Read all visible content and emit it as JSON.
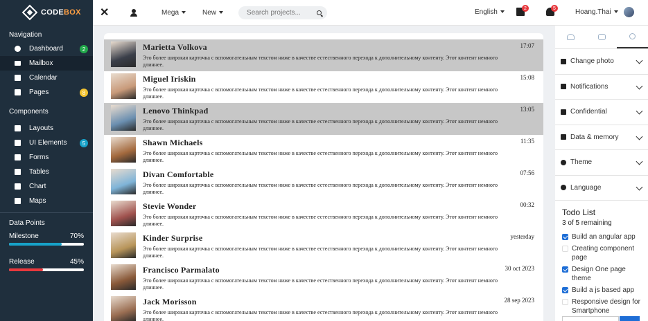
{
  "brand": {
    "text_a": "CODE",
    "text_b": "BOX"
  },
  "sidebar": {
    "navigation_heading": "Navigation",
    "nav_items": [
      {
        "label": "Dashboard",
        "icon": "dashboard-icon",
        "badge": "2"
      },
      {
        "label": "Mailbox",
        "icon": "envelope-icon",
        "active": true
      },
      {
        "label": "Calendar",
        "icon": "calendar-icon"
      },
      {
        "label": "Pages",
        "icon": "pages-icon",
        "badge": "8"
      }
    ],
    "components_heading": "Components",
    "component_items": [
      {
        "label": "Layouts",
        "icon": "layouts-icon"
      },
      {
        "label": "UI Elements",
        "icon": "ui-elements-icon",
        "badge": "5"
      },
      {
        "label": "Forms",
        "icon": "forms-icon"
      },
      {
        "label": "Tables",
        "icon": "tables-icon"
      },
      {
        "label": "Chart",
        "icon": "chart-icon"
      },
      {
        "label": "Maps",
        "icon": "map-icon"
      }
    ],
    "data_points_heading": "Data Points",
    "milestone": {
      "label": "Milestone",
      "value": "70%",
      "fraction": 0.7,
      "color": "#17a2c9"
    },
    "release": {
      "label": "Release",
      "value": "45%",
      "fraction": 0.45,
      "color": "#e8383d"
    }
  },
  "topbar": {
    "menu_mega": "Mega",
    "menu_new": "New",
    "search_placeholder": "Search projects...",
    "language": "English",
    "grid_badge": "2",
    "bell_badge": "5",
    "user_name": "Hoang.Thai"
  },
  "messages": [
    {
      "name": "Marietta Volkova",
      "time": "17:07",
      "text": "Это более широкая карточка с вспомогательным текстом ниже в качестве естественного перехода к дополнительному контенту. Этот контент немного длиннее.",
      "highlight": true,
      "avatar": "#3b3f4a"
    },
    {
      "name": "Miguel Iriskin",
      "time": "15:08",
      "text": "Это более широкая карточка с вспомогательным текстом ниже в качестве естественного перехода к дополнительному контенту. Этот контент немного длиннее.",
      "highlight": false,
      "avatar": "#c89a7a"
    },
    {
      "name": "Lenovo Thinkpad",
      "time": "13:05",
      "text": "Это более широкая карточка с вспомогательным текстом ниже в качестве естественного перехода к дополнительному контенту. Этот контент немного длиннее.",
      "highlight": true,
      "avatar": "#6b8fb0"
    },
    {
      "name": "Shawn Michaels",
      "time": "11:35",
      "text": "Это более широкая карточка с вспомогательным текстом ниже в качестве естественного перехода к дополнительному контенту. Этот контент немного длиннее.",
      "highlight": false,
      "avatar": "#a46a3e"
    },
    {
      "name": "Divan Comfortable",
      "time": "07:56",
      "text": "Это более широкая карточка с вспомогательным текстом ниже в качестве естественного перехода к дополнительному контенту. Этот контент немного длиннее.",
      "highlight": false,
      "avatar": "#7fb4d8"
    },
    {
      "name": "Stevie Wonder",
      "time": "00:32",
      "text": "Это более широкая карточка с вспомогательным текстом ниже в качестве естественного перехода к дополнительному контенту. Этот контент немного длиннее.",
      "highlight": false,
      "avatar": "#a0524e"
    },
    {
      "name": "Kinder Surprise",
      "time": "yesterday",
      "text": "Это более широкая карточка с вспомогательным текстом ниже в качестве естественного перехода к дополнительному контенту. Этот контент немного длиннее.",
      "highlight": false,
      "avatar": "#b8955a"
    },
    {
      "name": "Francisco Parmalato",
      "time": "30 oct 2023",
      "text": "Это более широкая карточка с вспомогательным текстом ниже в качестве естественного перехода к дополнительному контенту. Этот контент немного длиннее.",
      "highlight": false,
      "avatar": "#8a5a3a"
    },
    {
      "name": "Jack Morisson",
      "time": "28 sep 2023",
      "text": "Это более широкая карточка с вспомогательным текстом ниже в качестве естественного перехода к дополнительному контенту. Этот контент немного длиннее.",
      "highlight": false,
      "avatar": "#9a6e52"
    }
  ],
  "right_panel": {
    "sections": [
      {
        "label": "Change photo",
        "icon": "photo-icon"
      },
      {
        "label": "Notifications",
        "icon": "bell-icon"
      },
      {
        "label": "Confidential",
        "icon": "lock-icon"
      },
      {
        "label": "Data & memory",
        "icon": "database-icon"
      },
      {
        "label": "Theme",
        "icon": "theme-icon"
      },
      {
        "label": "Language",
        "icon": "globe-icon"
      }
    ],
    "todo_title": "Todo List",
    "todo_remaining": "3 of 5 remaining",
    "todos": [
      {
        "label": "Build an angular app",
        "checked": true
      },
      {
        "label": "Creating component page",
        "checked": false
      },
      {
        "label": "Design One page theme",
        "checked": true
      },
      {
        "label": "Build a js based app",
        "checked": true
      },
      {
        "label": "Responsive design for Smartphone",
        "checked": false
      }
    ]
  }
}
